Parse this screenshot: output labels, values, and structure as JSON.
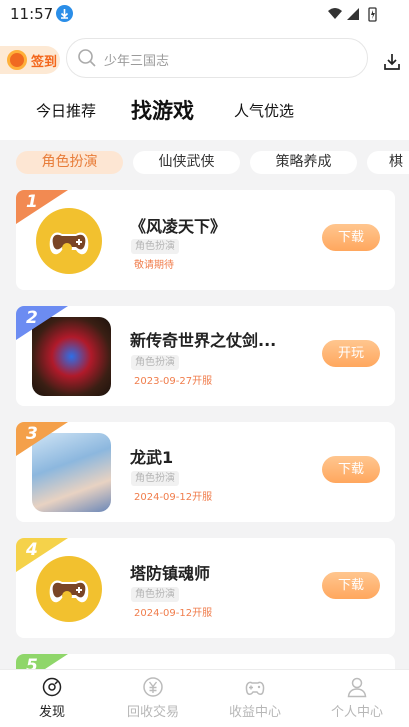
{
  "status_bar": {
    "time": "11:57"
  },
  "header": {
    "checkin_label": "签到",
    "search_placeholder": "少年三国志"
  },
  "tabs": [
    {
      "label": "今日推荐",
      "active": false
    },
    {
      "label": "找游戏",
      "active": true
    },
    {
      "label": "人气优选",
      "active": false
    }
  ],
  "categories": [
    {
      "label": "角色扮演",
      "active": true
    },
    {
      "label": "仙侠武侠",
      "active": false
    },
    {
      "label": "策略养成",
      "active": false
    },
    {
      "label": "棋",
      "active": false
    }
  ],
  "games": [
    {
      "rank": "1",
      "rank_color": "#f28a52",
      "name": "《风凌天下》",
      "tag": "角色扮演",
      "status": "敬请期待",
      "button": "下载",
      "icon": "gamepad-icon"
    },
    {
      "rank": "2",
      "rank_color": "#6c8cf2",
      "name": "新传奇世界之仗剑...",
      "tag": "角色扮演",
      "status": "2023-09-27开服",
      "button": "开玩",
      "icon": "game-art-icon"
    },
    {
      "rank": "3",
      "rank_color": "#f4a04a",
      "name": "龙武1",
      "tag": "角色扮演",
      "status": "2024-09-12开服",
      "button": "下载",
      "icon": "game-art-icon"
    },
    {
      "rank": "4",
      "rank_color": "#f5d24a",
      "name": "塔防镇魂师",
      "tag": "角色扮演",
      "status": "2024-09-12开服",
      "button": "下载",
      "icon": "gamepad-icon"
    },
    {
      "rank": "5",
      "rank_color": "#8fd66a"
    }
  ],
  "bottom_nav": [
    {
      "label": "发现",
      "active": true
    },
    {
      "label": "回收交易",
      "active": false
    },
    {
      "label": "收益中心",
      "active": false
    },
    {
      "label": "个人中心",
      "active": false
    }
  ]
}
